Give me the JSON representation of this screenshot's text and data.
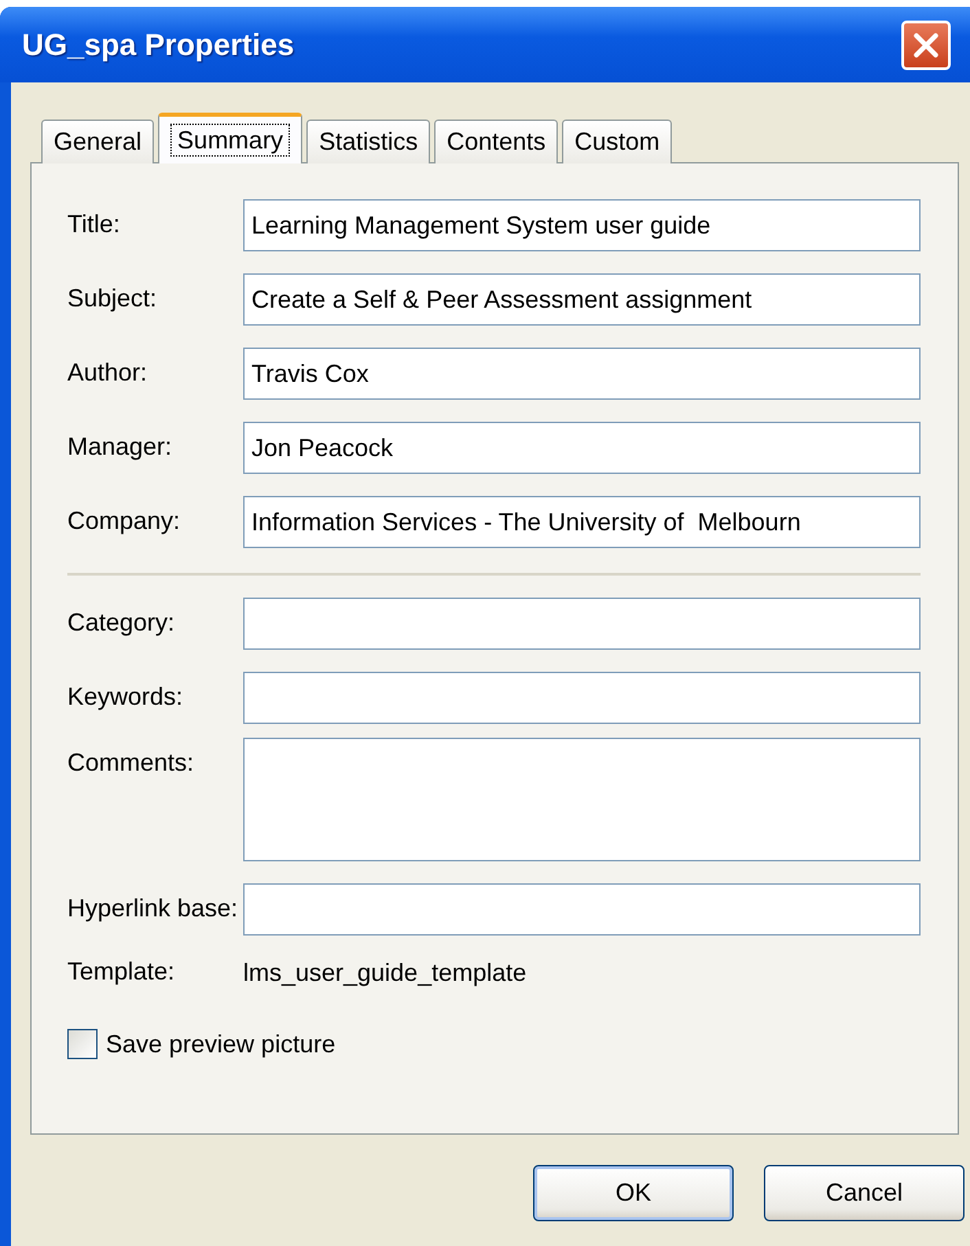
{
  "window": {
    "title": "UG_spa Properties"
  },
  "tabs": [
    {
      "label": "General",
      "selected": false
    },
    {
      "label": "Summary",
      "selected": true
    },
    {
      "label": "Statistics",
      "selected": false
    },
    {
      "label": "Contents",
      "selected": false
    },
    {
      "label": "Custom",
      "selected": false
    }
  ],
  "fields": [
    {
      "kind": "line",
      "label": "Title:",
      "value": "Learning Management System user guide"
    },
    {
      "kind": "line",
      "label": "Subject:",
      "value": "Create a Self & Peer Assessment assignment"
    },
    {
      "kind": "line",
      "label": "Author:",
      "value": "Travis Cox"
    },
    {
      "kind": "line",
      "label": "Manager:",
      "value": "Jon Peacock"
    },
    {
      "kind": "line",
      "label": "Company:",
      "value": "Information Services - The University of  Melbourn"
    },
    {
      "kind": "separator"
    },
    {
      "kind": "line",
      "label": "Category:"
    },
    {
      "kind": "line",
      "label": "Keywords:"
    },
    {
      "kind": "area",
      "label": "Comments:"
    },
    {
      "kind": "line",
      "label": "Hyperlink base:"
    },
    {
      "kind": "text",
      "label": "Template:",
      "value": "lms_user_guide_template"
    }
  ],
  "save_preview": {
    "label": "Save preview picture",
    "checked": false
  },
  "buttons": [
    {
      "label": "OK",
      "default": true
    },
    {
      "label": "Cancel",
      "default": false
    }
  ]
}
